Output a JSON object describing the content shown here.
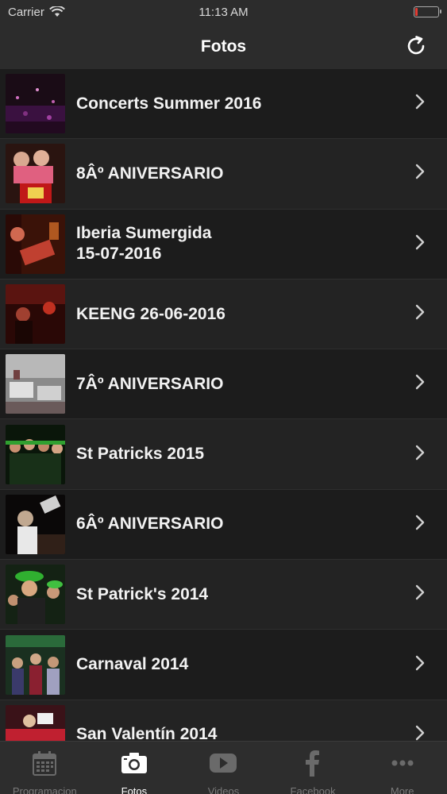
{
  "status": {
    "carrier": "Carrier",
    "time": "11:13 AM",
    "battery_level": 0.1
  },
  "nav": {
    "title": "Fotos"
  },
  "albums": [
    {
      "title": "Concerts Summer 2016"
    },
    {
      "title": "8Âº ANIVERSARIO"
    },
    {
      "title": "Iberia Sumergida\n15-07-2016"
    },
    {
      "title": "KEENG 26-06-2016"
    },
    {
      "title": "7Âº ANIVERSARIO"
    },
    {
      "title": "St Patricks 2015"
    },
    {
      "title": "6Âº ANIVERSARIO"
    },
    {
      "title": "St Patrick's 2014"
    },
    {
      "title": "Carnaval 2014"
    },
    {
      "title": "San Valentín 2014"
    }
  ],
  "tabs": [
    {
      "label": "Programacion",
      "icon": "calendar-icon"
    },
    {
      "label": "Fotos",
      "icon": "camera-icon",
      "active": true
    },
    {
      "label": "Videos",
      "icon": "video-play-icon"
    },
    {
      "label": "Facebook",
      "icon": "facebook-icon"
    },
    {
      "label": "More",
      "icon": "more-icon"
    }
  ],
  "colors": {
    "background": "#1b1b1b",
    "bar": "#2c2c2c",
    "active_tab": "#ffffff",
    "inactive_tab": "#7a7a7a",
    "battery": "#e23b32"
  }
}
